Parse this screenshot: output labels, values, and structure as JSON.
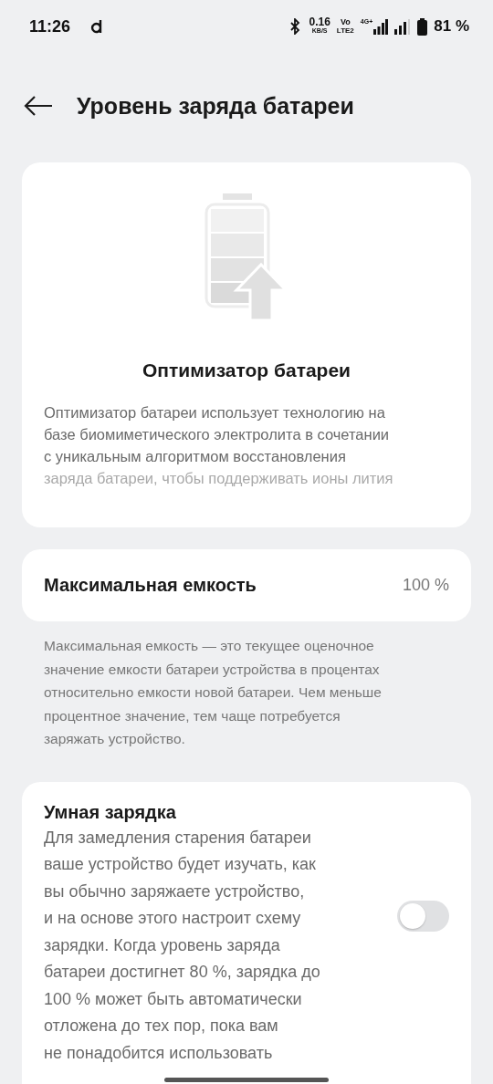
{
  "status_bar": {
    "time": "11:26",
    "speed_value": "0.16",
    "speed_unit": "KB/S",
    "volte_top": "Vo",
    "volte_bottom": "LTE2",
    "network": "4G+",
    "battery_percent": "81 %"
  },
  "header": {
    "title": "Уровень заряда батареи"
  },
  "optimizer_card": {
    "title": "Оптимизатор батареи",
    "description_lines": [
      "Оптимизатор батареи использует технологию на",
      "базе биомиметического электролита в сочетании",
      "с уникальным алгоритмом восстановления",
      "заряда батареи, чтобы поддерживать ионы лития"
    ]
  },
  "capacity_card": {
    "label": "Максимальная емкость",
    "value": "100 %"
  },
  "capacity_note_lines": [
    "Максимальная емкость — это текущее оценочное",
    "значение емкости батареи устройства в процентах",
    "относительно емкости новой батареи. Чем меньше",
    "процентное значение, тем чаще потребуется",
    "заряжать устройство."
  ],
  "smart_charging": {
    "title": "Умная зарядка",
    "description_lines": [
      "Для замедления старения батареи",
      "ваше устройство будет изучать, как",
      "вы обычно заряжаете устройство,",
      "и на основе этого настроит схему",
      "зарядки. Когда уровень заряда",
      "батареи достигнет 80 %, зарядка до",
      "100 % может быть автоматически",
      "отложена до тех пор, пока вам",
      "не понадобится использовать"
    ],
    "on": false
  }
}
